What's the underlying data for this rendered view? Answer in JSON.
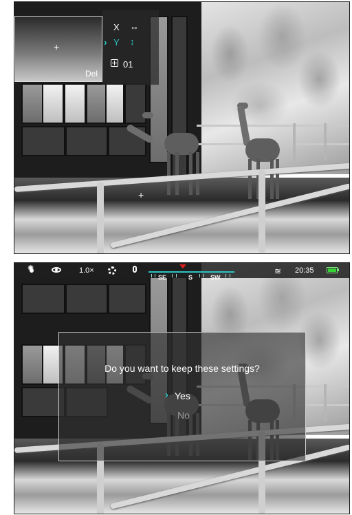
{
  "top_panel": {
    "pip": {
      "delete_label": "Del",
      "crosshair_icon": "crosshair-icon"
    },
    "axis_menu": {
      "rows": [
        {
          "label": "X",
          "arrow": "↔",
          "selected": false
        },
        {
          "label": "Y",
          "arrow": "↕",
          "selected": true
        },
        {
          "label": "01",
          "icon": "picture-in-picture-icon",
          "selected": false
        }
      ],
      "selection_color": "#29c6c6"
    },
    "scene_crosshair": "+"
  },
  "bottom_panel": {
    "status_bar": {
      "icons": [
        "brightness-icon",
        "eye-icon",
        "settings-gear-icon",
        "microphone-icon",
        "wifi-icon",
        "battery-icon"
      ],
      "zoom": "1.0×",
      "compass": {
        "left": "SE",
        "center": "S",
        "right": "SW"
      },
      "time": "20:35",
      "battery_color": "#36d336",
      "accent_color": "#2bc3c3",
      "compass_marker_color": "#e02020"
    },
    "dialog": {
      "question": "Do you want to keep these settings?",
      "options": [
        {
          "label": "Yes",
          "selected": true
        },
        {
          "label": "No",
          "selected": false
        }
      ]
    }
  }
}
